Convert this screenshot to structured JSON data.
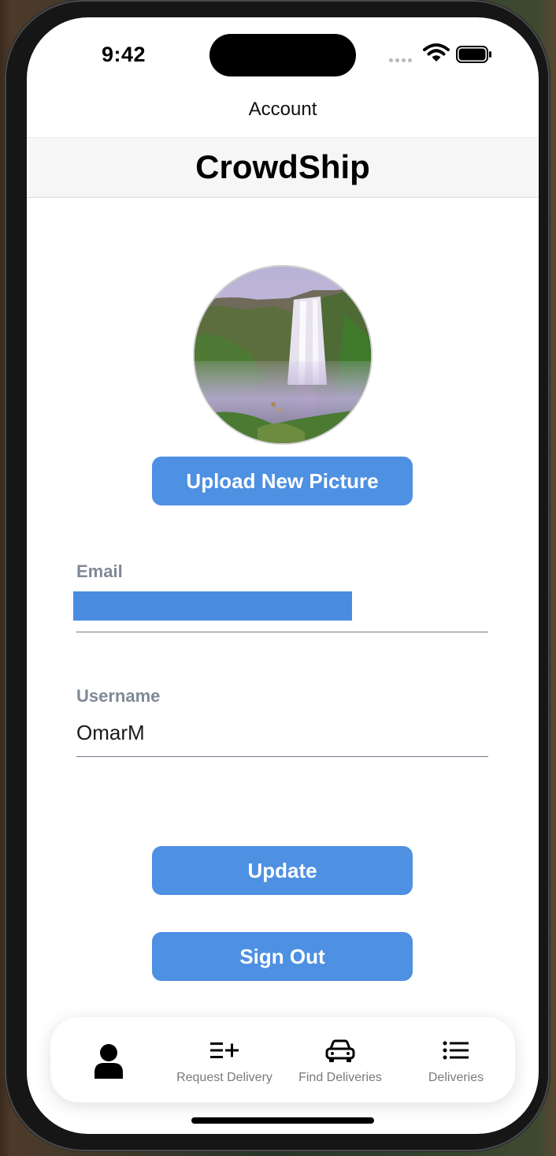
{
  "status": {
    "time": "9:42"
  },
  "nav": {
    "title": "Account"
  },
  "header": {
    "app_name": "CrowdShip"
  },
  "profile": {
    "upload_button": "Upload New Picture",
    "email_label": "Email",
    "email_value": "",
    "username_label": "Username",
    "username_value": "OmarM"
  },
  "actions": {
    "update": "Update",
    "sign_out": "Sign Out"
  },
  "tabs": [
    {
      "label": "",
      "icon": "person-icon"
    },
    {
      "label": "Request Delivery",
      "icon": "list-plus-icon"
    },
    {
      "label": "Find Deliveries",
      "icon": "car-icon"
    },
    {
      "label": "Deliveries",
      "icon": "list-icon"
    }
  ],
  "colors": {
    "accent": "#4e90e2",
    "label": "#7f8a97"
  }
}
